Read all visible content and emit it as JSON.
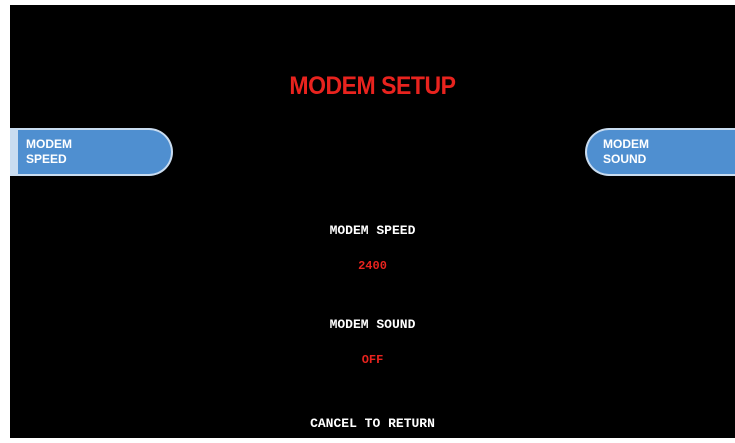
{
  "colors": {
    "background": "#000000",
    "title": "#e8231e",
    "value": "#e8231e",
    "label": "#ffffff",
    "button_fill": "#4f8fd0",
    "button_border": "#c9dcf0"
  },
  "title": "MODEM SETUP",
  "left_button": {
    "line1": "MODEM",
    "line2": "SPEED"
  },
  "right_button": {
    "line1": "MODEM",
    "line2": "SOUND"
  },
  "settings": [
    {
      "label": "MODEM SPEED",
      "value": "2400"
    },
    {
      "label": "MODEM SOUND",
      "value": "OFF"
    }
  ],
  "footer": "CANCEL TO RETURN"
}
